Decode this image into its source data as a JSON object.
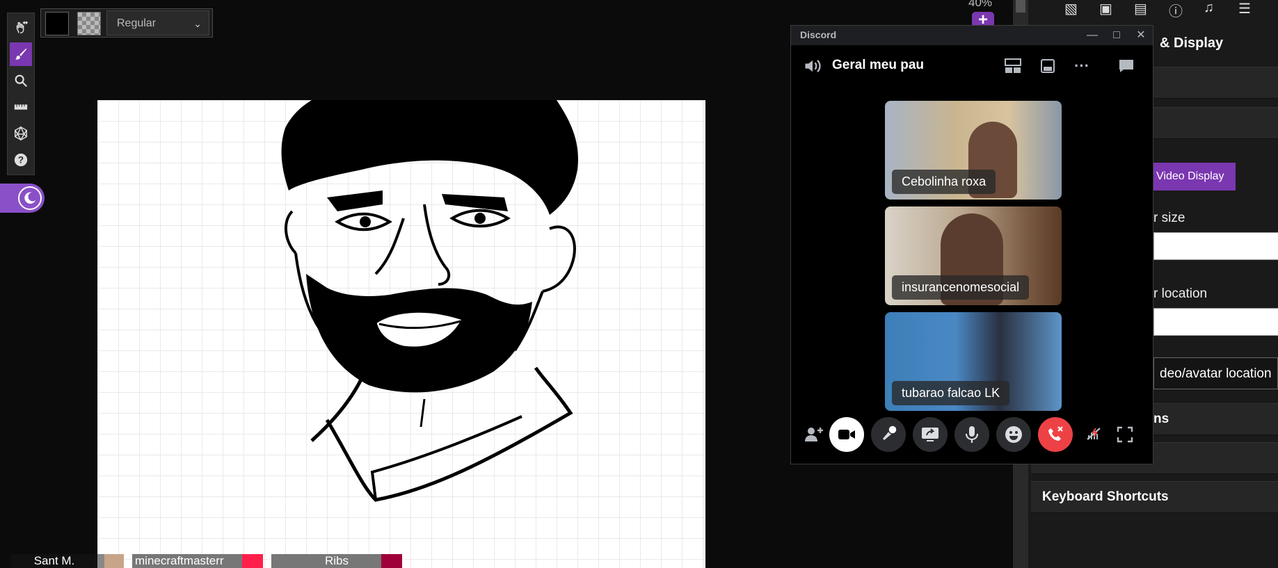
{
  "toolbar": {
    "tools": [
      "pan-tool",
      "brush-tool",
      "zoom-tool",
      "ruler-tool",
      "dice-tool",
      "help-tool"
    ]
  },
  "brush": {
    "style": "Regular"
  },
  "zoom": {
    "level": "40%",
    "plus_label": "+"
  },
  "sidebar": {
    "heading": "& Display",
    "tab_label": "Video Display",
    "size_label": "r size",
    "location_label": "r location",
    "video_location_value": "deo/avatar location",
    "section_partial": "ns",
    "keyboard_shortcuts": "Keyboard Shortcuts"
  },
  "discord": {
    "app_title": "Discord",
    "channel_name": "Geral meu pau",
    "participants": [
      {
        "name": "Cebolinha roxa"
      },
      {
        "name": "insurancenomesocial"
      },
      {
        "name": "tubarao falcao LK"
      }
    ],
    "colors": {
      "hangup": "#ed4245",
      "camera_on": "#ffffff"
    }
  },
  "players": [
    {
      "name": "Sant M."
    },
    {
      "name": "minecraftmasterr"
    },
    {
      "name": "Ribs"
    }
  ]
}
